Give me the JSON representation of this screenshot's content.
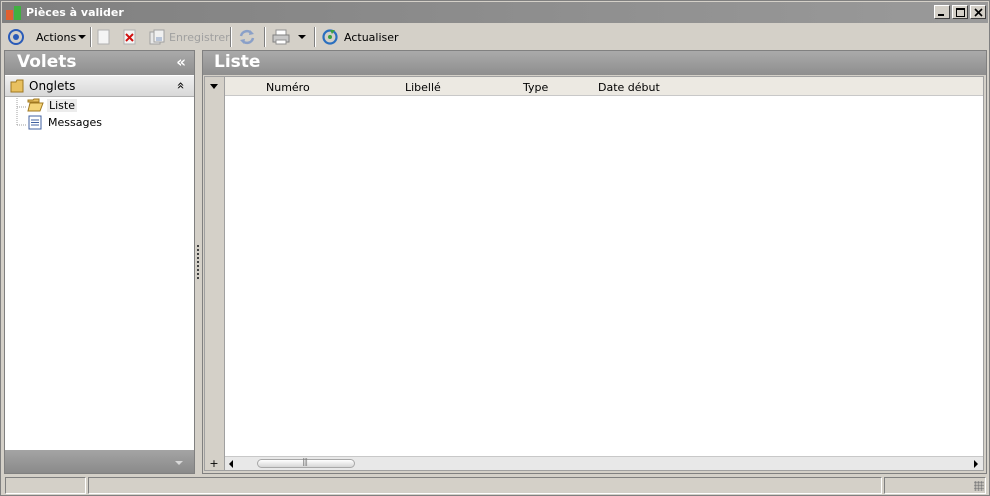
{
  "window": {
    "title": "Pièces à valider"
  },
  "toolbar": {
    "actions_label": "Actions",
    "save_label": "Enregistrer",
    "refresh_label": "Actualiser"
  },
  "left_panel": {
    "title": "Volets",
    "collapse_glyph": "«",
    "section_title": "Onglets",
    "section_glyph": "»",
    "items": [
      {
        "label": "Liste",
        "selected": true
      },
      {
        "label": "Messages",
        "selected": false
      }
    ]
  },
  "right_panel": {
    "title": "Liste",
    "columns": [
      "Numéro",
      "Libellé",
      "Type",
      "Date début"
    ],
    "rows": []
  },
  "colors": {
    "title_bar": "#808080",
    "header_gray": "#9c9c9c",
    "chrome": "#d4d0c8"
  }
}
